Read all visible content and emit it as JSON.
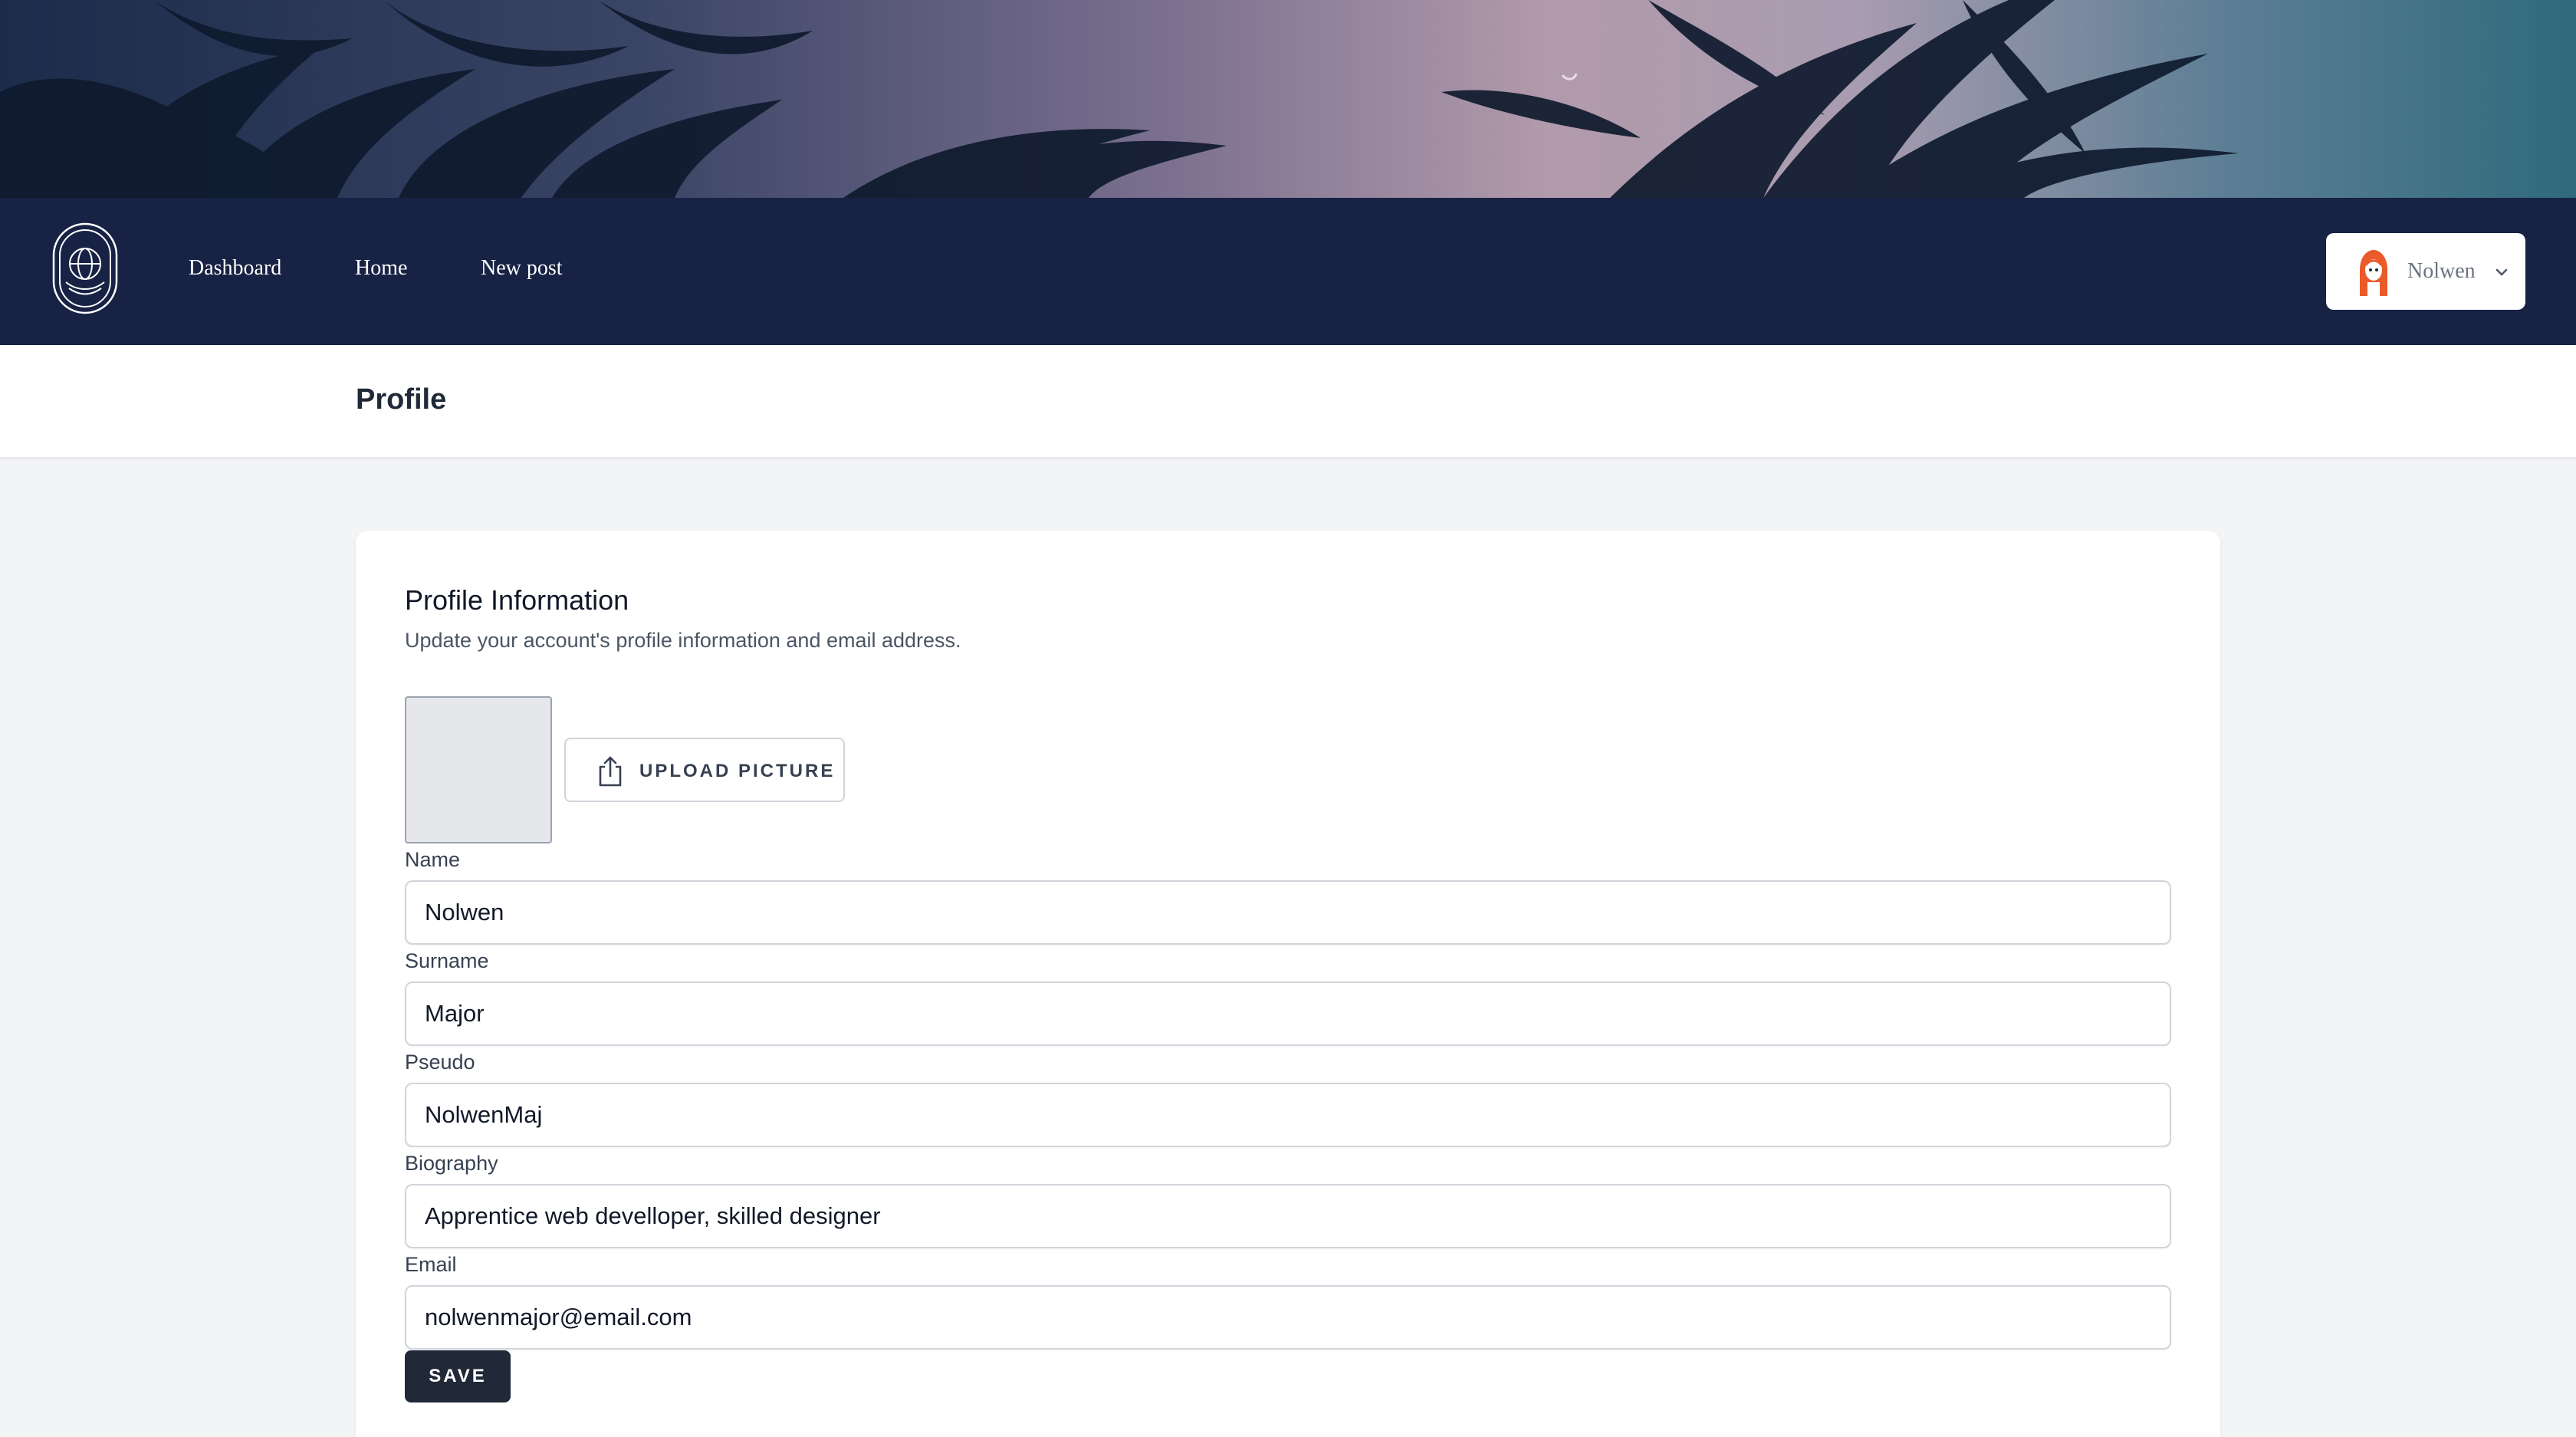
{
  "nav": {
    "links": [
      "Dashboard",
      "Home",
      "New post"
    ],
    "user_name": "Nolwen"
  },
  "header": {
    "title": "Profile"
  },
  "profile_form": {
    "title": "Profile Information",
    "description": "Update your account's profile information and email address.",
    "upload_label": "UPLOAD PICTURE",
    "fields": [
      {
        "label": "Name",
        "value": "Nolwen"
      },
      {
        "label": "Surname",
        "value": "Major"
      },
      {
        "label": "Pseudo",
        "value": "NolwenMaj"
      },
      {
        "label": "Biography",
        "value": "Apprentice web develloper, skilled designer"
      },
      {
        "label": "Email",
        "value": "nolwenmajor@email.com"
      }
    ],
    "save_label": "SAVE"
  },
  "colors": {
    "navbar": "#172244",
    "button_dark": "#1f2937",
    "avatar_accent": "#ea5a2a"
  },
  "icons": [
    "palm-tree-banner",
    "globe-emblem-logo",
    "user-avatar-icon",
    "chevron-down-icon",
    "upload-share-icon"
  ]
}
